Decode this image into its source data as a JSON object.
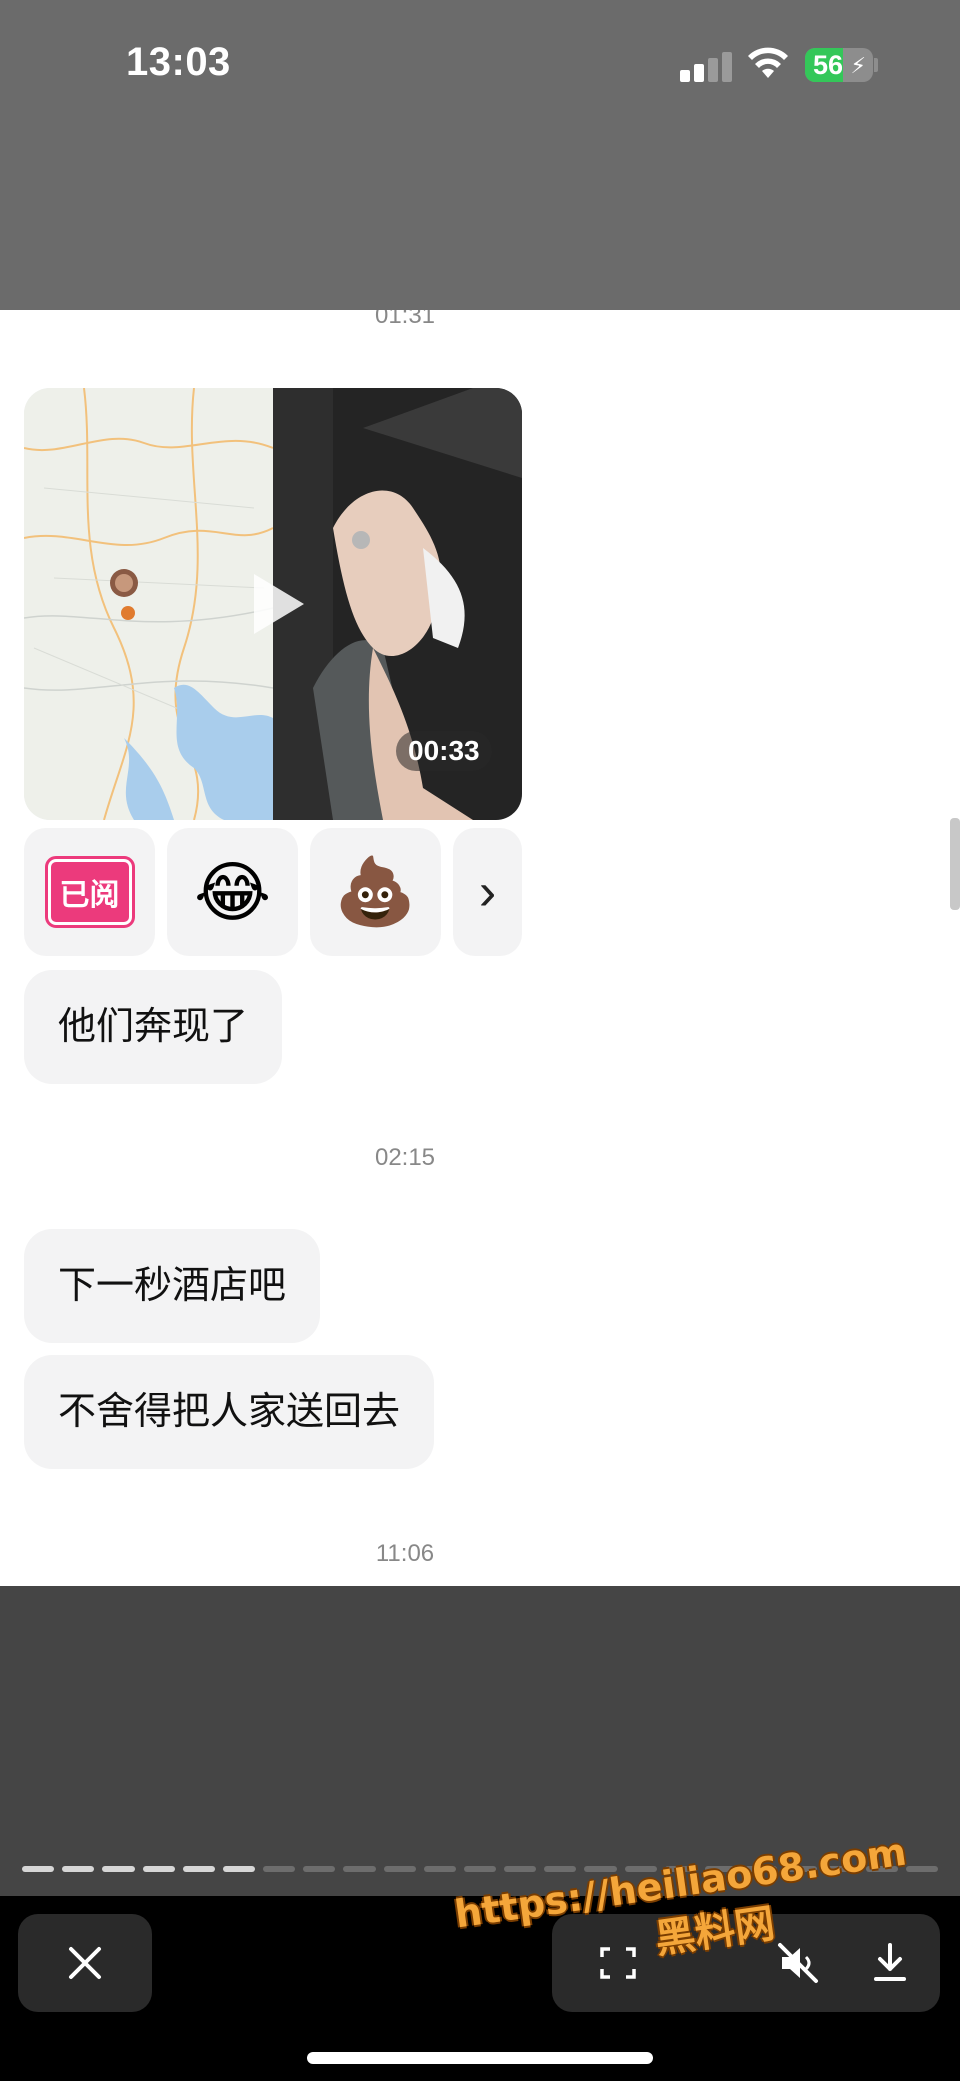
{
  "status_bar": {
    "time": "13:03",
    "battery": "56",
    "battery_level": 0.56
  },
  "chat": {
    "timestamp_top": "01:31",
    "video": {
      "duration": "00:33"
    },
    "reactions": {
      "read_label": "已阅",
      "emoji_laugh": "😂",
      "emoji_poop": "💩",
      "more_label": "›"
    },
    "messages_1": [
      "他们奔现了"
    ],
    "timestamp_mid": "02:15",
    "messages_2": [
      "下一秒酒店吧",
      "不舍得把人家送回去"
    ],
    "timestamp_bottom": "11:06"
  },
  "viewer": {
    "progress_total": 23,
    "progress_viewed": 6,
    "close_icon": "close-icon",
    "capture_icon": "scan-icon",
    "mute_icon": "speaker-muted-icon",
    "download_icon": "download-icon"
  },
  "watermark": {
    "url": "https://heiliao68.com",
    "name": "黑料网"
  },
  "colors": {
    "bubble": "#f3f3f4",
    "badge": "#ec3a7c",
    "watermark": "#f4a63a"
  }
}
